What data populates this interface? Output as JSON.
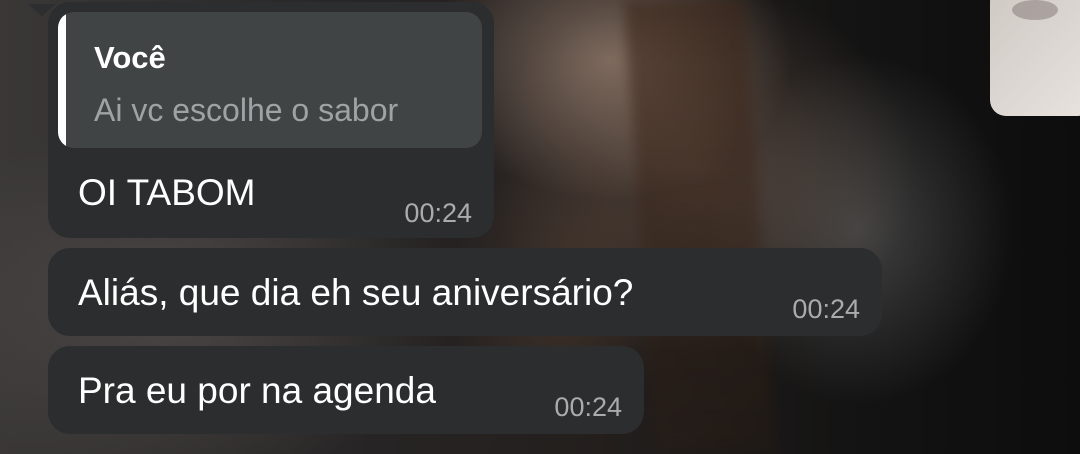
{
  "chat": {
    "messages": [
      {
        "reply": {
          "author": "Você",
          "text": "Ai vc escolhe o sabor"
        },
        "text": "OI TABOM",
        "time": "00:24"
      },
      {
        "text": "Aliás, que dia eh seu aniversário?",
        "time": "00:24"
      },
      {
        "text": "Pra eu por na agenda",
        "time": "00:24"
      }
    ]
  },
  "colors": {
    "bubble": "#2b2d2e",
    "reply_box": "#414445",
    "reply_bar": "#ffffff",
    "timestamp": "#a9acad"
  }
}
